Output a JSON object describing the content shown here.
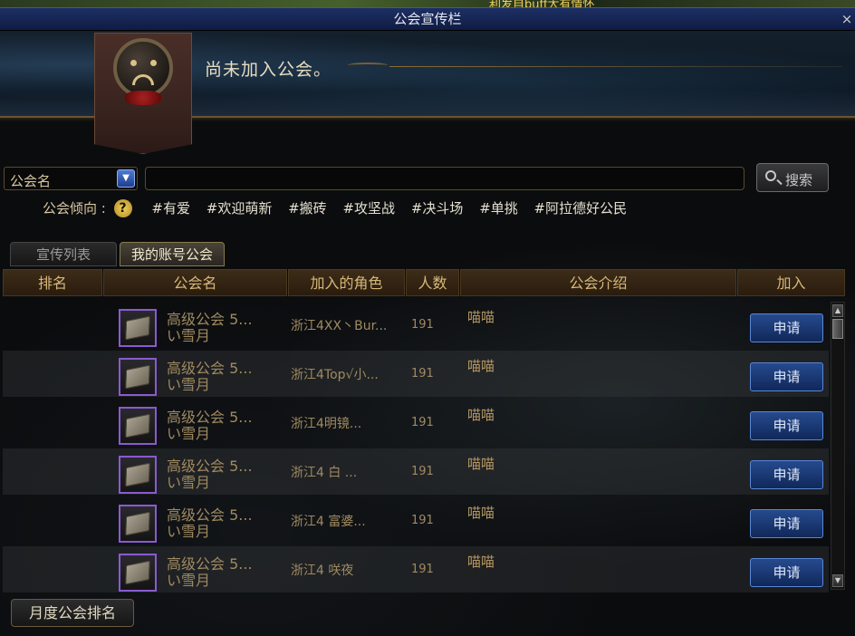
{
  "window": {
    "top_notice": "利发自buff大有情怀",
    "title": "公会宣传栏",
    "close": "×"
  },
  "banner": {
    "status_text": "尚未加入公会。"
  },
  "search": {
    "select_value": "公会名",
    "input_value": "",
    "button_label": "搜索"
  },
  "tags": {
    "label": "公会倾向 :",
    "help": "?",
    "items": [
      "#有爱",
      "#欢迎萌新",
      "#搬砖",
      "#攻坚战",
      "#决斗场",
      "#单挑",
      "#阿拉德好公民"
    ]
  },
  "tabs": [
    {
      "label": "宣传列表",
      "active": false
    },
    {
      "label": "我的账号公会",
      "active": true
    }
  ],
  "table": {
    "headers": [
      "排名",
      "公会名",
      "加入的角色",
      "人数",
      "公会介绍",
      "加入"
    ],
    "rows": [
      {
        "rank": "",
        "guild_line1": "高级公会 5...",
        "guild_line2": "い雪月",
        "character": "浙江4XX丶Bur...",
        "count": "191",
        "intro": "喵喵",
        "action": "申请"
      },
      {
        "rank": "",
        "guild_line1": "高级公会 5...",
        "guild_line2": "い雪月",
        "character": "浙江4Top√小...",
        "count": "191",
        "intro": "喵喵",
        "action": "申请"
      },
      {
        "rank": "",
        "guild_line1": "高级公会 5...",
        "guild_line2": "い雪月",
        "character": "浙江4明镜...",
        "count": "191",
        "intro": "喵喵",
        "action": "申请"
      },
      {
        "rank": "",
        "guild_line1": "高级公会 5...",
        "guild_line2": "い雪月",
        "character": "浙江4 白   ...",
        "count": "191",
        "intro": "喵喵",
        "action": "申请"
      },
      {
        "rank": "",
        "guild_line1": "高级公会 5...",
        "guild_line2": "い雪月",
        "character": "浙江4   富婆...",
        "count": "191",
        "intro": "喵喵",
        "action": "申请"
      },
      {
        "rank": "",
        "guild_line1": "高级公会 5...",
        "guild_line2": "い雪月",
        "character": "浙江4 咲夜",
        "count": "191",
        "intro": "喵喵",
        "action": "申请"
      }
    ]
  },
  "footer": {
    "monthly_ranking_button": "月度公会排名"
  }
}
